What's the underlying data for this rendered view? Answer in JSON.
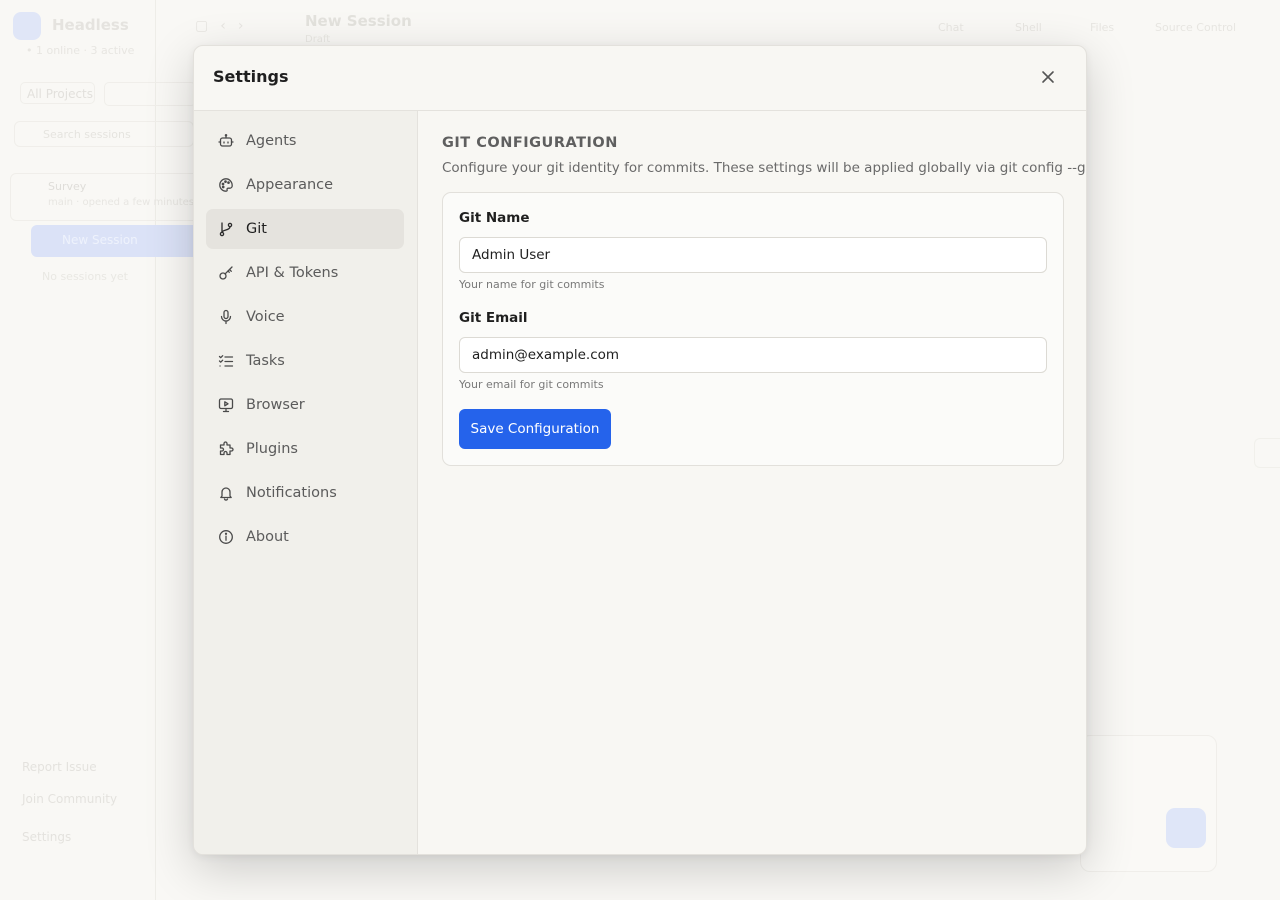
{
  "background": {
    "app_name": "Headless",
    "app_subtitle": "• 1 online · 3 active",
    "projects_label": "All Projects",
    "search_placeholder": "Search sessions",
    "session_title": "Survey",
    "session_subtitle": "main · opened a few minutes ago",
    "active_session": "New Session",
    "muted_item": "No sessions yet",
    "footer": [
      "Report Issue",
      "Join Community",
      "Settings"
    ],
    "header_title": "New Session",
    "header_subtitle": "Draft",
    "header_buttons": [
      "Chat",
      "Shell",
      "Files",
      "Source Control"
    ]
  },
  "modal": {
    "title": "Settings",
    "close_icon": "close-icon"
  },
  "nav": {
    "items": [
      {
        "label": "Agents",
        "icon": "robot-icon",
        "active": false
      },
      {
        "label": "Appearance",
        "icon": "palette-icon",
        "active": false
      },
      {
        "label": "Git",
        "icon": "git-branch-icon",
        "active": true
      },
      {
        "label": "API & Tokens",
        "icon": "key-icon",
        "active": false
      },
      {
        "label": "Voice",
        "icon": "microphone-icon",
        "active": false
      },
      {
        "label": "Tasks",
        "icon": "list-checks-icon",
        "active": false
      },
      {
        "label": "Browser",
        "icon": "monitor-play-icon",
        "active": false
      },
      {
        "label": "Plugins",
        "icon": "puzzle-icon",
        "active": false
      },
      {
        "label": "Notifications",
        "icon": "bell-icon",
        "active": false
      },
      {
        "label": "About",
        "icon": "info-icon",
        "active": false
      }
    ]
  },
  "git": {
    "section_title": "GIT CONFIGURATION",
    "description": "Configure your git identity for commits. These settings will be applied globally via git config --global",
    "name_label": "Git Name",
    "name_value": "Admin User",
    "name_hint": "Your name for git commits",
    "email_label": "Git Email",
    "email_value": "admin@example.com",
    "email_hint": "Your email for git commits",
    "save_label": "Save Configuration",
    "accent_color": "#2563eb"
  }
}
